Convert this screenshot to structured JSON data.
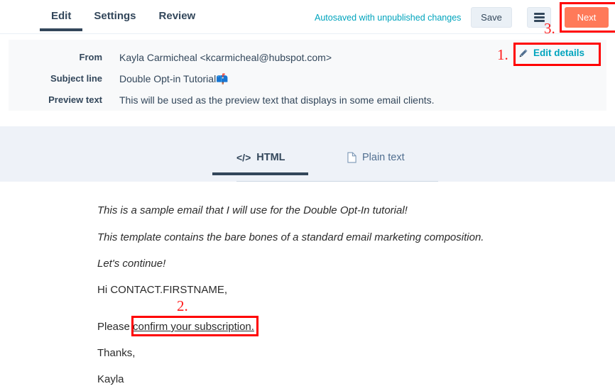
{
  "header": {
    "tabs": [
      {
        "label": "Edit",
        "active": true
      },
      {
        "label": "Settings",
        "active": false
      },
      {
        "label": "Review",
        "active": false
      }
    ],
    "autosave_status": "Autosaved with unpublished changes",
    "save_label": "Save",
    "menu_icon": "hamburger-menu-icon",
    "next_label": "Next",
    "next_color": "#ff7a59",
    "autosave_color": "#00a4bd",
    "active_tab_underline_color": "#33475b"
  },
  "details": {
    "rows": [
      {
        "label": "From",
        "value": "Kayla Carmicheal <kcarmicheal@hubspot.com>"
      },
      {
        "label": "Subject line",
        "value": "Double Opt-in Tutorial📫"
      },
      {
        "label": "Preview text",
        "value": "This will be used as the preview text that displays in some email clients."
      }
    ],
    "edit_details_label": "Edit details",
    "edit_details_icon": "pencil-icon",
    "edit_details_color": "#00a4bd"
  },
  "content_tabs": {
    "html": {
      "label": "HTML",
      "icon": "code-icon"
    },
    "plain": {
      "label": "Plain text",
      "icon": "document-icon"
    }
  },
  "email_body": {
    "lines": [
      {
        "text": "This is a sample email that I will use for the Double Opt-In tutorial!",
        "italic": true
      },
      {
        "text": "This template contains the bare bones of a standard email marketing composition.",
        "italic": true
      },
      {
        "text": "Let's continue!",
        "italic": true
      },
      {
        "text": "Hi CONTACT.FIRSTNAME,",
        "italic": false
      },
      {
        "text": "Thanks,",
        "italic": false
      },
      {
        "text": "Kayla",
        "italic": false
      }
    ],
    "link_line": {
      "prefix": "Please ",
      "link_text": "confirm your subscription."
    }
  },
  "annotations": {
    "color": "#ff0000",
    "markers": [
      {
        "number": "1.",
        "target": "edit-details-link"
      },
      {
        "number": "2.",
        "target": "confirm-subscription-link"
      },
      {
        "number": "3.",
        "target": "next-button"
      }
    ]
  }
}
